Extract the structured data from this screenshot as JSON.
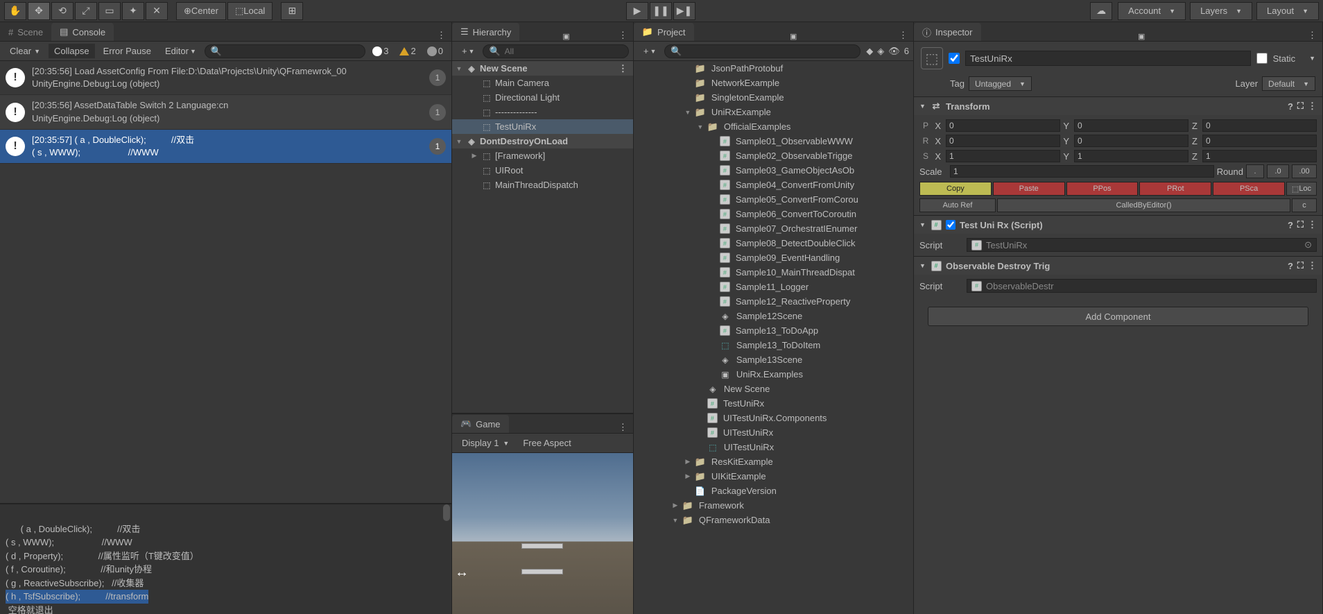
{
  "toolbar": {
    "pivot": "Center",
    "handle": "Local",
    "account": "Account",
    "layers": "Layers",
    "layout": "Layout"
  },
  "tabs": {
    "scene": "Scene",
    "console": "Console",
    "hierarchy": "Hierarchy",
    "game": "Game",
    "project": "Project",
    "inspector": "Inspector"
  },
  "console": {
    "clear": "Clear",
    "collapse": "Collapse",
    "errorPause": "Error Pause",
    "editor": "Editor",
    "errCount": "3",
    "warnCount": "2",
    "infoCount": "0",
    "logs": [
      {
        "time": "[20:35:56]",
        "msg": "Load AssetConfig From File:D:\\Data\\Projects\\Unity\\QFramewrok_00",
        "stack": "UnityEngine.Debug:Log (object)",
        "count": "1"
      },
      {
        "time": "[20:35:56]",
        "msg": "AssetDataTable Switch 2 Language:cn",
        "stack": "UnityEngine.Debug:Log (object)",
        "count": "1"
      },
      {
        "time": "[20:35:57]",
        "msg": "( a , DoubleClick);          //双击",
        "stack": "( s , WWW);                   //WWW",
        "count": "1"
      }
    ],
    "detail": "( a , DoubleClick);          //双击\n( s , WWW);                   //WWW\n( d , Property);              //属性监听（T键改变值）\n( f , Coroutine);              //和unity协程\n( g , ReactiveSubscribe);   //收集器\n( h , TsfSubscribe);          //transform\n 空格就退出"
  },
  "hierarchy": {
    "search": "All",
    "scenes": [
      {
        "name": "New Scene",
        "items": [
          "Main Camera",
          "Directional Light",
          "--------------",
          "TestUniRx"
        ]
      },
      {
        "name": "DontDestroyOnLoad",
        "items": [
          "[Framework]",
          "UIRoot",
          "MainThreadDispatch"
        ]
      }
    ]
  },
  "game": {
    "display": "Display 1",
    "aspect": "Free Aspect"
  },
  "project": {
    "visCount": "6",
    "items": [
      {
        "name": "JsonPathProtobuf",
        "type": "folder",
        "indent": 4
      },
      {
        "name": "NetworkExample",
        "type": "folder",
        "indent": 4
      },
      {
        "name": "SingletonExample",
        "type": "folder",
        "indent": 4
      },
      {
        "name": "UniRxExample",
        "type": "folder",
        "indent": 4,
        "open": true
      },
      {
        "name": "OfficialExamples",
        "type": "folder",
        "indent": 5,
        "open": true
      },
      {
        "name": "Sample01_ObservableWWW",
        "type": "script",
        "indent": 6
      },
      {
        "name": "Sample02_ObservableTrigge",
        "type": "script",
        "indent": 6
      },
      {
        "name": "Sample03_GameObjectAsOb",
        "type": "script",
        "indent": 6
      },
      {
        "name": "Sample04_ConvertFromUnity",
        "type": "script",
        "indent": 6
      },
      {
        "name": "Sample05_ConvertFromCorou",
        "type": "script",
        "indent": 6
      },
      {
        "name": "Sample06_ConvertToCoroutin",
        "type": "script",
        "indent": 6
      },
      {
        "name": "Sample07_OrchestratIEnumer",
        "type": "script",
        "indent": 6
      },
      {
        "name": "Sample08_DetectDoubleClick",
        "type": "script",
        "indent": 6
      },
      {
        "name": "Sample09_EventHandling",
        "type": "script",
        "indent": 6
      },
      {
        "name": "Sample10_MainThreadDispat",
        "type": "script",
        "indent": 6
      },
      {
        "name": "Sample11_Logger",
        "type": "script",
        "indent": 6
      },
      {
        "name": "Sample12_ReactiveProperty",
        "type": "script",
        "indent": 6
      },
      {
        "name": "Sample12Scene",
        "type": "scene",
        "indent": 6
      },
      {
        "name": "Sample13_ToDoApp",
        "type": "script",
        "indent": 6
      },
      {
        "name": "Sample13_ToDoItem",
        "type": "prefab",
        "indent": 6
      },
      {
        "name": "Sample13Scene",
        "type": "scene",
        "indent": 6
      },
      {
        "name": "UniRx.Examples",
        "type": "asm",
        "indent": 6
      },
      {
        "name": "New Scene",
        "type": "scene",
        "indent": 5
      },
      {
        "name": "TestUniRx",
        "type": "script",
        "indent": 5
      },
      {
        "name": "UITestUniRx.Components",
        "type": "script",
        "indent": 5
      },
      {
        "name": "UITestUniRx",
        "type": "script",
        "indent": 5
      },
      {
        "name": "UITestUniRx",
        "type": "prefab",
        "indent": 5
      },
      {
        "name": "ResKitExample",
        "type": "folder",
        "indent": 4,
        "arrow": true
      },
      {
        "name": "UIKitExample",
        "type": "folder",
        "indent": 4,
        "arrow": true
      },
      {
        "name": "PackageVersion",
        "type": "text",
        "indent": 4
      },
      {
        "name": "Framework",
        "type": "folder",
        "indent": 3,
        "arrow": true
      },
      {
        "name": "QFrameworkData",
        "type": "folder",
        "indent": 3,
        "open": true
      }
    ]
  },
  "inspector": {
    "name": "TestUniRx",
    "static": "Static",
    "tag": "Tag",
    "tagVal": "Untagged",
    "layer": "Layer",
    "layerVal": "Default",
    "transform": {
      "title": "Transform",
      "P": "P",
      "R": "R",
      "S": "S",
      "x": "X",
      "y": "Y",
      "z": "Z",
      "px": "0",
      "py": "0",
      "pz": "0",
      "rx": "0",
      "ry": "0",
      "rz": "0",
      "sx": "1",
      "sy": "1",
      "sz": "1",
      "scale": "Scale",
      "scaleVal": "1",
      "round": "Round",
      "dot": ".",
      "p0": ".0",
      "p00": ".00",
      "copy": "Copy",
      "paste": "Paste",
      "ppos": "PPos",
      "prot": "PRot",
      "psca": "PSca",
      "loc": "Loc",
      "autoRef": "Auto Ref",
      "calledBy": "CalledByEditor()",
      "c": "c"
    },
    "testScript": {
      "title": "Test Uni Rx (Script)",
      "scriptLabel": "Script",
      "scriptVal": "TestUniRx"
    },
    "observable": {
      "title": "Observable Destroy Trig",
      "scriptLabel": "Script",
      "scriptVal": "ObservableDestr"
    },
    "addComponent": "Add Component"
  }
}
